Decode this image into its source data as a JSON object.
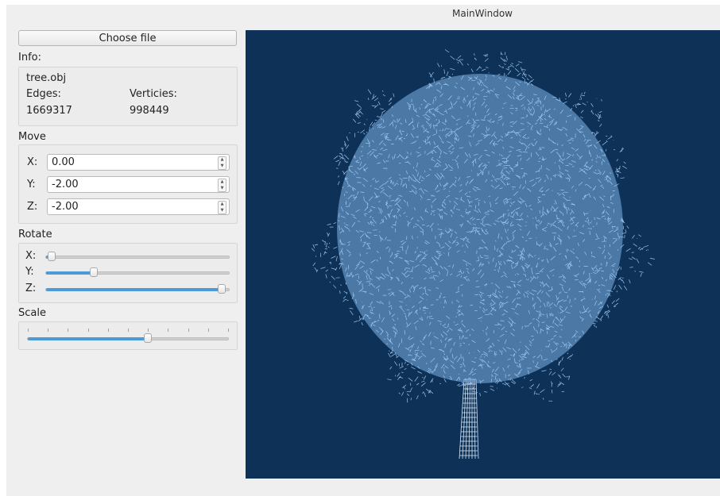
{
  "window": {
    "title": "MainWindow"
  },
  "choose_button": {
    "label": "Choose file"
  },
  "info": {
    "label": "Info:",
    "filename": "tree.obj",
    "edges_label": "Edges:",
    "vertices_label": "Verticies:",
    "edges_value": "1669317",
    "vertices_value": "998449"
  },
  "move": {
    "label": "Move",
    "x_label": "X:",
    "x_value": "0.00",
    "y_label": "Y:",
    "y_value": "-2.00",
    "z_label": "Z:",
    "z_value": "-2.00"
  },
  "rotate": {
    "label": "Rotate",
    "x_label": "X:",
    "x_level": 0.03,
    "y_label": "Y:",
    "y_level": 0.26,
    "z_label": "Z:",
    "z_level": 0.96
  },
  "scale": {
    "label": "Scale",
    "level": 0.6
  },
  "colors": {
    "viewport_bg": "#0e3157",
    "mesh": "#9cc8f2",
    "accent": "#4d9ad6"
  },
  "viewport_content": "tree wireframe mesh"
}
